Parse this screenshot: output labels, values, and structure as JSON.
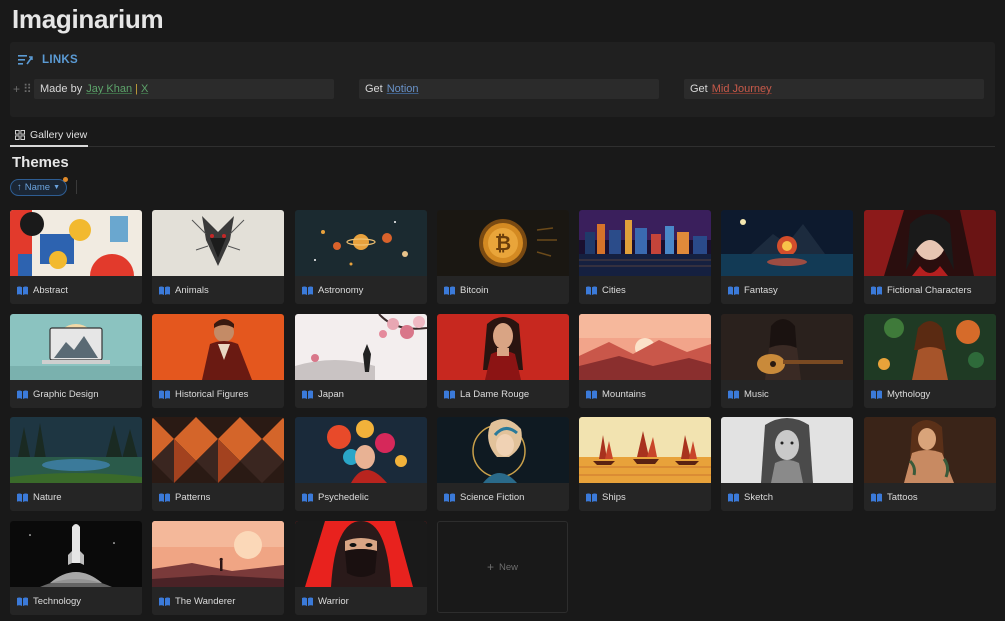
{
  "page": {
    "title": "Imaginarium"
  },
  "links": {
    "heading": "LINKS",
    "col1": {
      "prefix": "Made by",
      "link": "Jay Khan",
      "sep": "|",
      "link2": "X"
    },
    "col2": {
      "prefix": "Get",
      "link": "Notion"
    },
    "col3": {
      "prefix": "Get",
      "link": "Mid Journey"
    }
  },
  "view": {
    "tab_label": "Gallery view"
  },
  "section": {
    "title": "Themes",
    "sort_label": "Name"
  },
  "cards": [
    {
      "label": "Abstract"
    },
    {
      "label": "Animals"
    },
    {
      "label": "Astronomy"
    },
    {
      "label": "Bitcoin"
    },
    {
      "label": "Cities"
    },
    {
      "label": "Fantasy"
    },
    {
      "label": "Fictional Characters"
    },
    {
      "label": "Graphic Design"
    },
    {
      "label": "Historical Figures"
    },
    {
      "label": "Japan"
    },
    {
      "label": "La Dame Rouge"
    },
    {
      "label": "Mountains"
    },
    {
      "label": "Music"
    },
    {
      "label": "Mythology"
    },
    {
      "label": "Nature"
    },
    {
      "label": "Patterns"
    },
    {
      "label": "Psychedelic"
    },
    {
      "label": "Science Fiction"
    },
    {
      "label": "Ships"
    },
    {
      "label": "Sketch"
    },
    {
      "label": "Tattoos"
    },
    {
      "label": "Technology"
    },
    {
      "label": "The Wanderer"
    },
    {
      "label": "Warrior"
    }
  ],
  "new_card": {
    "label": "New"
  },
  "colors": {
    "accent": "#5b9bd5",
    "background": "#191919"
  }
}
